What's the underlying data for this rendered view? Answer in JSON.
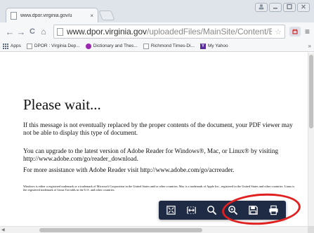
{
  "window": {
    "tab_title": "www.dpor.virginia.gov/u",
    "tab_close": "×"
  },
  "toolbar": {
    "back": "←",
    "forward": "→",
    "reload": "C",
    "home": "⌂",
    "url_host": "www.dpor.virginia.gov",
    "url_path": "/uploadedFiles/MainSite/Content/Boards/",
    "star": "☆",
    "menu": "≡"
  },
  "bookmarks": {
    "items": [
      {
        "label": "Apps",
        "icon": "apps-icon"
      },
      {
        "label": "DPOR : Virginia Dep...",
        "icon": "page-icon"
      },
      {
        "label": "Dictionary and Thes...",
        "icon": "dictionary-icon"
      },
      {
        "label": "Richmond Times-Di...",
        "icon": "page-icon"
      },
      {
        "label": "My Yahoo",
        "icon": "yahoo-icon"
      }
    ],
    "more": "»"
  },
  "document": {
    "heading": "Please wait...",
    "p1": "If this message is not eventually replaced by the proper contents of the document, your PDF viewer may not be able to display this type of document.",
    "p2": "You can upgrade to the latest version of Adobe Reader for Windows®, Mac, or Linux® by visiting  http://www.adobe.com/go/reader_download.",
    "p3": "For more assistance with Adobe Reader visit  http://www.adobe.com/go/acrreader.",
    "fine_print": "Windows is either a registered trademark or a trademark of Microsoft Corporation in the United States and/or other countries. Mac is a trademark of Apple Inc., registered in the United States and other countries. Linux is the registered trademark of Linus Torvalds in the U.S. and other countries."
  },
  "pdf_toolbar": {
    "buttons": [
      "fit-page-icon",
      "fit-width-icon",
      "zoom-out-icon",
      "zoom-in-icon",
      "save-icon",
      "print-icon"
    ],
    "background": "#1f2a44",
    "annotation_color": "#e02020"
  }
}
